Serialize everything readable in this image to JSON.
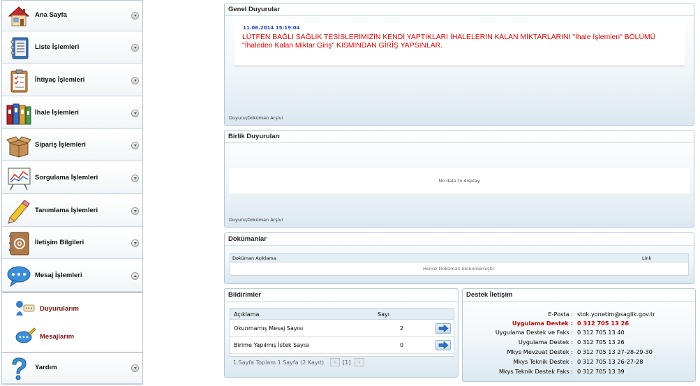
{
  "sidebar": {
    "items": [
      {
        "label": "Ana Sayfa",
        "icon": "home-icon"
      },
      {
        "label": "Liste İşlemleri",
        "icon": "list-notebook-icon"
      },
      {
        "label": "İhtiyaç İşlemleri",
        "icon": "checklist-clipboard-icon"
      },
      {
        "label": "İhale İşlemleri",
        "icon": "binders-icon"
      },
      {
        "label": "Sipariş İşlemleri",
        "icon": "open-box-icon"
      },
      {
        "label": "Sorgulama İşlemleri",
        "icon": "chart-board-icon"
      },
      {
        "label": "Tanımlama İşlemleri",
        "icon": "pencil-icon"
      },
      {
        "label": "İletişim Bilgileri",
        "icon": "address-book-icon"
      },
      {
        "label": "Mesaj İşlemleri",
        "icon": "speech-bubble-icon"
      },
      {
        "label": "Yardım",
        "icon": "question-mark-icon"
      }
    ],
    "submenu": [
      {
        "label": "Duyurularım",
        "icon": "announcement-icon"
      },
      {
        "label": "Mesajlarım",
        "icon": "message-write-icon"
      }
    ]
  },
  "genel": {
    "title": "Genel Duyurular",
    "date": "11.06.2014 15:19:04",
    "message": "LÜTFEN BAĞLI SAĞLIK TESİSLERİMİZİN KENDİ YAPTIKLARI İHALELERİN KALAN MİKTARLARINI \"İhale İşlemleri\" BÖLÜMÜ \"İhaleden Kalan Miktar Giriş\" KISMINDAN GİRİŞ YAPSINLAR.",
    "archive": "Duyuru\\Doküman Arşivi"
  },
  "birlik": {
    "title": "Birlik Duyuruları",
    "empty": "No data to display",
    "archive": "Duyuru\\Doküman Arşivi"
  },
  "dokuman": {
    "title": "Dokümanlar",
    "col_desc": "Doküman Açıklama",
    "col_link": "Link",
    "empty": "Henüz Doküman Eklenmemiştir."
  },
  "bildirim": {
    "title": "Bildirimler",
    "col_desc": "Açıklama",
    "col_count": "Sayı",
    "rows": [
      {
        "label": "Okunmamış Mesaj Sayısı",
        "count": "2"
      },
      {
        "label": "Birime Yapılmış İstek Sayısı",
        "count": "0"
      }
    ],
    "pager": "1.Sayfa Toplam 1 Sayfa (2 Kayıt)",
    "page": "[1]"
  },
  "destek": {
    "title": "Destek İletişim",
    "rows": [
      {
        "label": "E-Posta :",
        "value": "stok.yonetim@saglik.gov.tr"
      },
      {
        "label": "Uygulama Destek :",
        "value": "0 312 705 13 26"
      },
      {
        "label": "Uygulama Destek ve Faks :",
        "value": "0 312 705 13 40"
      },
      {
        "label": "Uygulama Destek :",
        "value": "0 312 705 13 26"
      },
      {
        "label": "Mkys Mevzuat Destek :",
        "value": "0 312 705 13 27-28-29-30"
      },
      {
        "label": "Mkys Teknik Destek :",
        "value": "0 312 705 13 26-27-28"
      },
      {
        "label": "Mkys Teknik Destek Faks :",
        "value": "0 312 705 13 39"
      }
    ]
  },
  "colors": {
    "accent": "#b5c8d8",
    "announcement_red": "#e60000",
    "date_blue": "#2040c0",
    "submenu_label": "#7a1414",
    "highlight_red": "#cc0000"
  }
}
